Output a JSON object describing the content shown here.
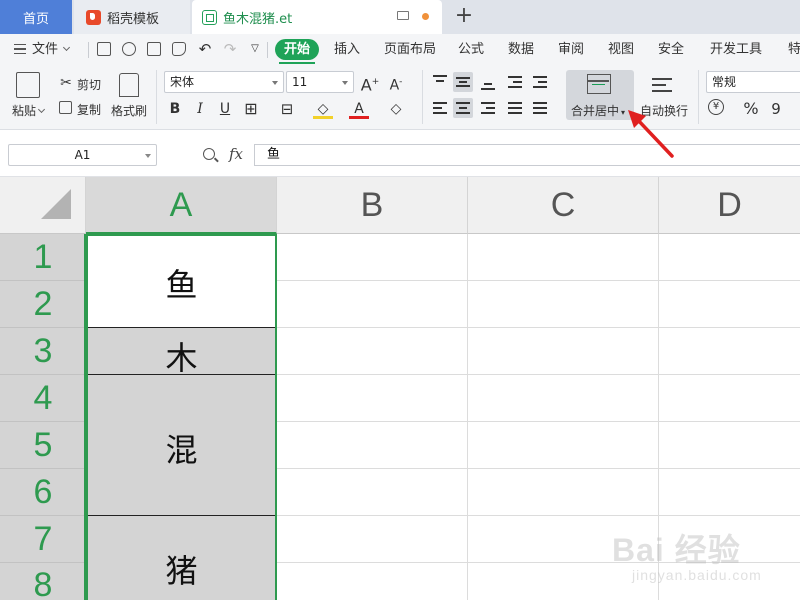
{
  "tabs": {
    "home": "首页",
    "template": "稻壳模板",
    "file": "鱼木混猪.et",
    "add": "+"
  },
  "menu": {
    "file": "文件",
    "items": [
      "开始",
      "插入",
      "页面布局",
      "公式",
      "数据",
      "审阅",
      "视图",
      "安全",
      "开发工具",
      "特"
    ]
  },
  "ribbon": {
    "paste": "粘贴",
    "cut": "剪切",
    "copy": "复制",
    "format_painter": "格式刷",
    "font_name": "宋体",
    "font_size": "11",
    "grow": "A",
    "shrink": "A",
    "bold": "B",
    "italic": "I",
    "underline": "U",
    "font_color": "A",
    "merge_center": "合并居中",
    "wrap_text": "自动换行",
    "number_format": "常规",
    "currency": "¥",
    "percent": "%",
    "comma": "9"
  },
  "formula": {
    "name_box": "A1",
    "fx": "fx",
    "value": "鱼"
  },
  "sheet": {
    "columns": [
      "A",
      "B",
      "C",
      "D"
    ],
    "rows": [
      "1",
      "2",
      "3",
      "4",
      "5",
      "6",
      "7",
      "8"
    ],
    "cells": [
      "鱼",
      "木",
      "混",
      "猪"
    ]
  },
  "colors": {
    "accent": "#1fa358",
    "selection": "#2e9a4f",
    "arrow": "#e02020"
  },
  "watermark": {
    "brand": "Bai 经验",
    "site": "jingyan.baidu.com"
  }
}
